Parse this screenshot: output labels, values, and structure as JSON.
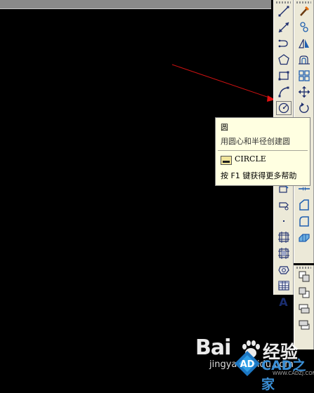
{
  "tooltip": {
    "title": "圆",
    "description": "用圆心和半径创建圆",
    "command": "CIRCLE",
    "help": "按 F1 键获得更多帮助"
  },
  "draw_toolbar": {
    "buttons": [
      "line-icon",
      "construction-line-icon",
      "polyline-icon",
      "polygon-icon",
      "rectangle-icon",
      "arc-icon",
      "circle-icon",
      "revision-cloud-icon",
      "spline-icon",
      "ellipse-icon",
      "ellipse-arc-icon",
      "insert-block-icon",
      "make-block-icon",
      "point-icon",
      "hatch-icon",
      "gradient-icon",
      "region-icon",
      "table-icon",
      "multiline-text-icon"
    ],
    "text_button_label": "A"
  },
  "modify_toolbar": {
    "buttons": [
      "erase-icon",
      "copy-icon",
      "mirror-icon",
      "offset-icon",
      "array-icon",
      "move-icon",
      "rotate-icon",
      "scale-icon",
      "stretch-icon",
      "trim-icon",
      "extend-icon",
      "break-icon",
      "join-icon",
      "chamfer-icon",
      "fillet-icon",
      "explode-icon"
    ]
  },
  "draw_order_toolbar": {
    "buttons": [
      "bring-to-front-icon",
      "send-to-back-icon",
      "bring-above-icon",
      "send-under-icon"
    ]
  },
  "watermark": {
    "brand": "Bai",
    "product": "经验",
    "url": "jingyan.baidu.com",
    "site_name": "CAD之家",
    "site_url": "WWW.CADZJ.COM",
    "logo_letters": "AD"
  },
  "colors": {
    "canvas": "#000000",
    "toolbar": "#ece9d8",
    "tooltip_bg": "#ffffe1",
    "leader_line": "#cc1111",
    "icon_blue": "#1f5fb0"
  }
}
